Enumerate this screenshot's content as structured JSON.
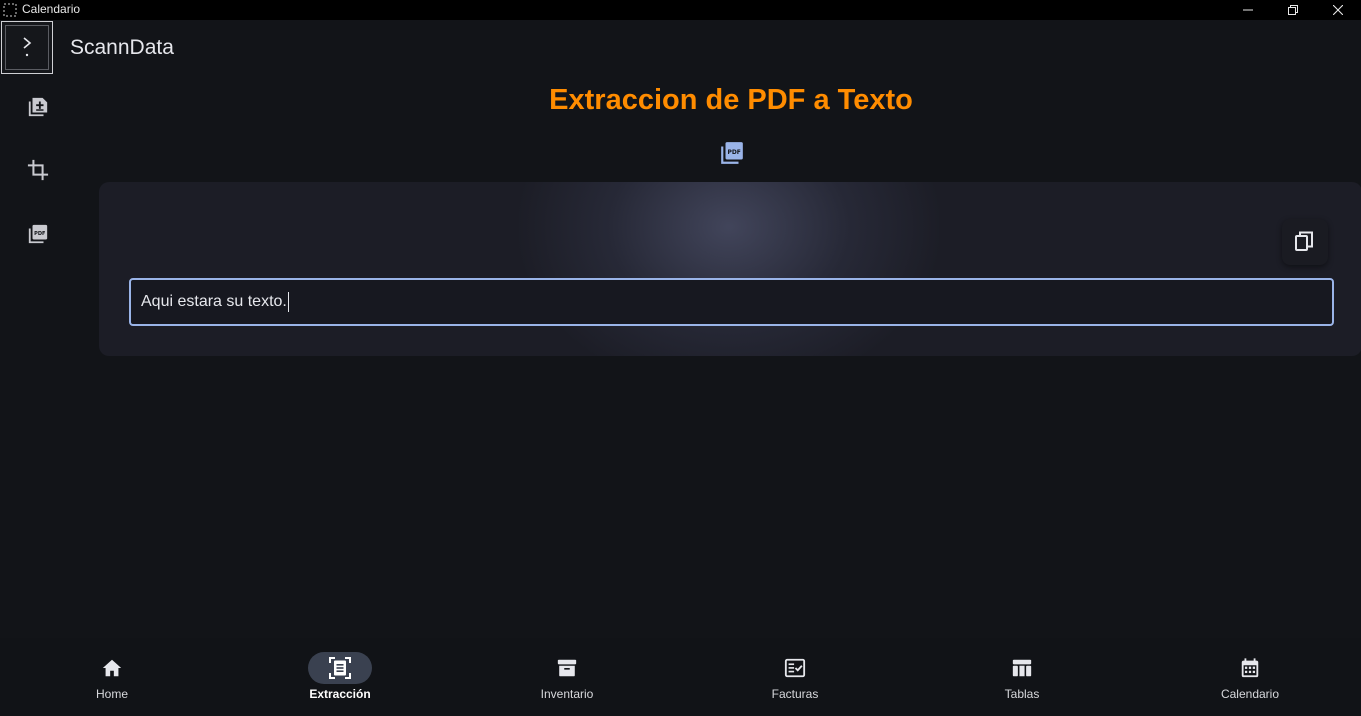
{
  "window": {
    "title": "Calendario",
    "controls": [
      "minimize",
      "maximize",
      "close"
    ]
  },
  "app": {
    "brand": "ScannData"
  },
  "sidebar": {
    "items": [
      {
        "icon": "add-document-icon"
      },
      {
        "icon": "crop-icon"
      },
      {
        "icon": "pdf-icon"
      }
    ]
  },
  "main": {
    "title": "Extraccion de PDF a Texto",
    "output_field": {
      "value": "Aqui estara su texto."
    }
  },
  "bottom_nav": {
    "items": [
      {
        "label": "Home",
        "icon": "home-icon"
      },
      {
        "label": "Extracción",
        "icon": "document-scanner-icon",
        "active": true
      },
      {
        "label": "Inventario",
        "icon": "archive-icon"
      },
      {
        "label": "Facturas",
        "icon": "fact-check-icon"
      },
      {
        "label": "Tablas",
        "icon": "table-icon"
      },
      {
        "label": "Calendario",
        "icon": "calendar-icon"
      }
    ]
  },
  "colors": {
    "accent_title": "#ff8c00",
    "field_border": "#9ab4e8",
    "background": "#121418",
    "card": "#1c1d26",
    "active_pill": "#3a4150"
  }
}
